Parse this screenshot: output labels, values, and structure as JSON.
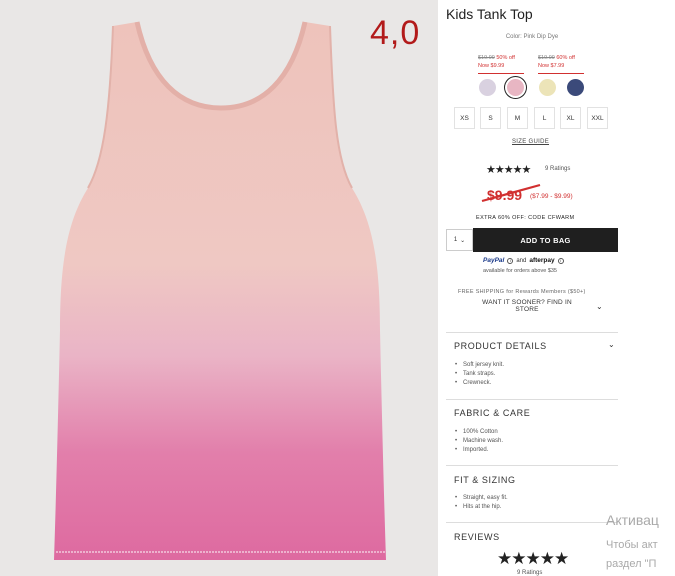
{
  "image_annotation": "4,0",
  "product": {
    "title": "Kids Tank Top",
    "color_label": "Color: Pink Dip Dye",
    "swatch_prices": [
      {
        "was": "$19.99",
        "off": "50% off",
        "now": "Now $9.99"
      },
      {
        "was": "$19.99",
        "off": "60% off",
        "now": "Now $7.99"
      }
    ],
    "swatch_colors": [
      "#d9d1e0",
      "#e8b6c3",
      "#ece4b8",
      "#3b4a7a"
    ],
    "sizes": [
      "XS",
      "S",
      "M",
      "L",
      "XL",
      "XXL"
    ],
    "size_guide": "SIZE GUIDE",
    "rating_stars": "★★★★★",
    "ratings_count": "9 Ratings",
    "price_main": "$9.99",
    "price_range": "($7.99 - $9.99)",
    "promo": "EXTRA 60% OFF: CODE CFWARM",
    "qty": "1",
    "add_to_bag": "ADD TO BAG",
    "paypal": "PayPal",
    "and": "and",
    "afterpay": "afterpay",
    "pay_sub": "available for orders above $35",
    "shipping": "FREE SHIPPING for Rewards Members ($50+)",
    "find_in_store": "WANT IT SOONER? FIND IN STORE"
  },
  "sections": {
    "details_title": "PRODUCT DETAILS",
    "details": [
      "Soft jersey knit.",
      "Tank straps.",
      "Crewneck."
    ],
    "fabric_title": "FABRIC & CARE",
    "fabric": [
      "100% Cotton",
      "Machine wash.",
      "Imported."
    ],
    "fit_title": "FIT & SIZING",
    "fit": [
      "Straight, easy fit.",
      "Hits at the hip."
    ],
    "reviews_title": "REVIEWS",
    "reviews_stars": "★★★★★",
    "reviews_count": "9 Ratings"
  },
  "overlay": {
    "activate": "Активац",
    "line1": "Чтобы акт",
    "line2": "раздел \"П"
  },
  "colors": {
    "sale_red": "#d13030",
    "button_dark": "#1f1f1f",
    "annotation_red": "#b21a1a"
  }
}
